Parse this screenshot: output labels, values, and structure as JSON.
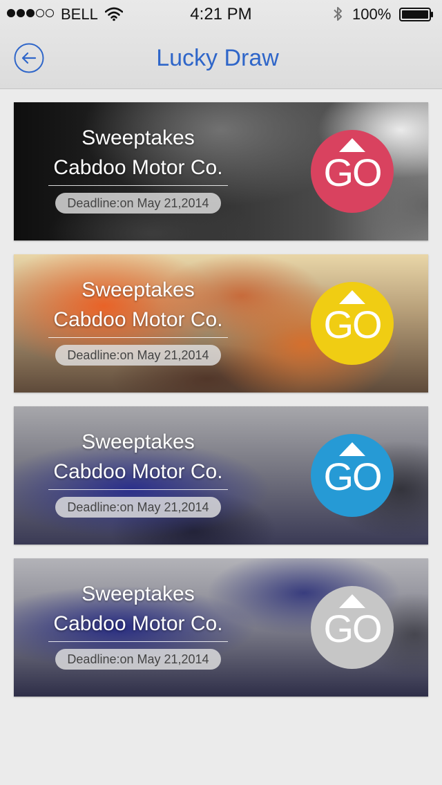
{
  "status_bar": {
    "carrier": "BELL",
    "time": "4:21 PM",
    "battery": "100%"
  },
  "nav": {
    "title": "Lucky Draw",
    "back_icon": "back-arrow-icon"
  },
  "colors": {
    "title": "#2f66c9",
    "go_red": "#d9425f",
    "go_yellow": "#f0cd13",
    "go_blue": "#269ad5",
    "go_gray": "#c6c6c6"
  },
  "cards": [
    {
      "line1": "Sweeptakes",
      "line2": "Cabdoo Motor Co.",
      "deadline": "Deadline:on May 21,2014",
      "go_label": "GO",
      "go_color": "#d9425f"
    },
    {
      "line1": "Sweeptakes",
      "line2": "Cabdoo Motor Co.",
      "deadline": "Deadline:on May 21,2014",
      "go_label": "GO",
      "go_color": "#f0cd13"
    },
    {
      "line1": "Sweeptakes",
      "line2": "Cabdoo Motor Co.",
      "deadline": "Deadline:on May 21,2014",
      "go_label": "GO",
      "go_color": "#269ad5"
    },
    {
      "line1": "Sweeptakes",
      "line2": "Cabdoo Motor Co.",
      "deadline": "Deadline:on May 21,2014",
      "go_label": "GO",
      "go_color": "#c6c6c6"
    }
  ]
}
